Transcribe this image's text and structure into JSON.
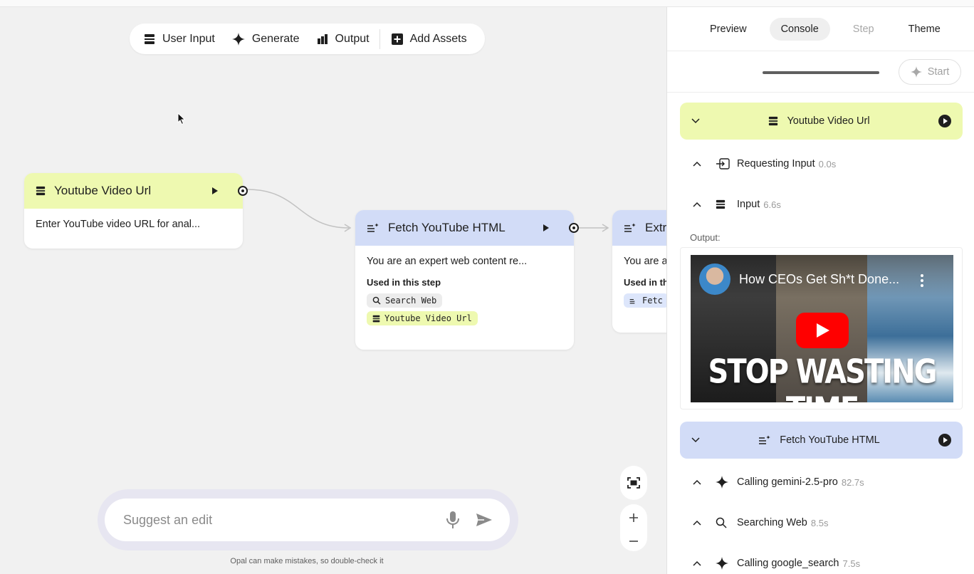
{
  "toolbar": {
    "user_input": "User Input",
    "generate": "Generate",
    "output": "Output",
    "add_assets": "Add Assets"
  },
  "nodes": {
    "youtube_url": {
      "title": "Youtube Video Url",
      "body": "Enter YouTube video URL for anal...",
      "color": "#eef9b0"
    },
    "fetch_html": {
      "title": "Fetch YouTube HTML",
      "body": "You are an expert web content re...",
      "used_label": "Used in this step",
      "chips": [
        "Search Web",
        "Youtube Video Url"
      ],
      "color": "#d2dcf7"
    },
    "extract": {
      "title": "Extr",
      "body": "You are a",
      "used_label": "Used in th",
      "chip": "Fetc"
    }
  },
  "suggest": {
    "placeholder": "Suggest an edit",
    "disclaimer": "Opal can make mistakes, so double-check it"
  },
  "panel": {
    "tabs": [
      "Preview",
      "Console",
      "Step",
      "Theme"
    ],
    "active_tab": "Console",
    "start_label": "Start",
    "steps": [
      {
        "title": "Youtube Video Url",
        "logs": [
          {
            "label": "Requesting Input",
            "time": "0.0s"
          },
          {
            "label": "Input",
            "time": "6.6s"
          }
        ],
        "output_label": "Output:",
        "video": {
          "title": "How CEOs Get Sh*t Done...",
          "caption": "STOP WASTING TIME"
        }
      },
      {
        "title": "Fetch YouTube HTML",
        "logs": [
          {
            "label": "Calling gemini-2.5-pro",
            "time": "82.7s"
          },
          {
            "label": "Searching Web",
            "time": "8.5s"
          },
          {
            "label": "Calling google_search",
            "time": "7.5s"
          }
        ]
      }
    ]
  },
  "colors": {
    "input_accent": "#eef9b0",
    "generate_accent": "#d2dcf7"
  }
}
